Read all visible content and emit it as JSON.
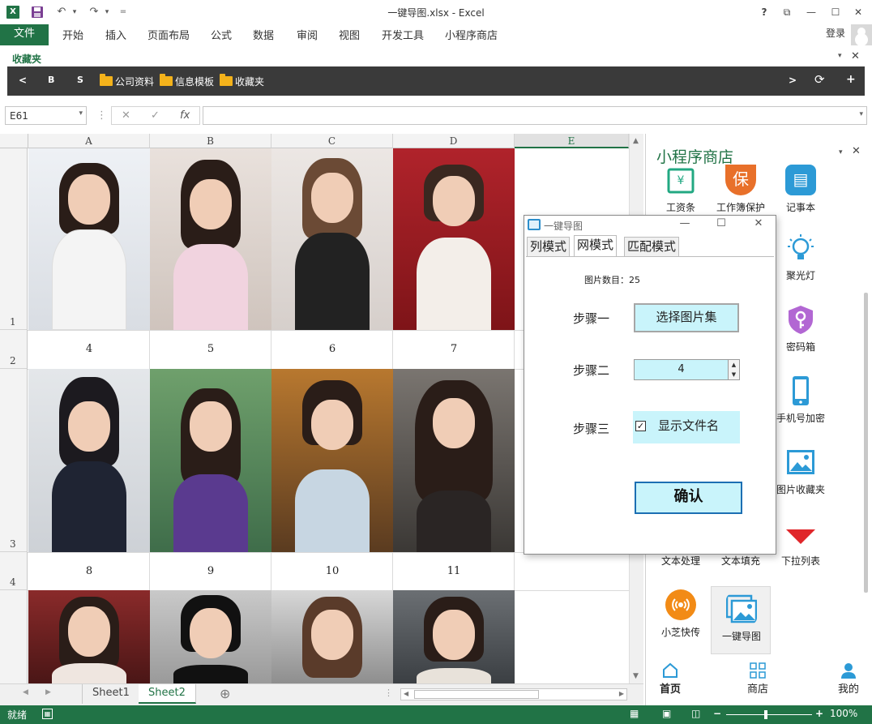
{
  "window": {
    "title": "一键导图.xlsx - Excel",
    "controls": {
      "help": "?",
      "restore_ribbon": "⧉",
      "minimize": "—",
      "maximize": "☐",
      "close": "✕"
    },
    "login": "登录"
  },
  "quick_access": {
    "app_icon": "X",
    "save_icon": "save-icon",
    "undo_icon": "undo-icon",
    "redo_icon": "redo-icon",
    "customize": "="
  },
  "ribbon": {
    "file": "文件",
    "tabs": [
      "开始",
      "插入",
      "页面布局",
      "公式",
      "数据",
      "审阅",
      "视图",
      "开发工具",
      "小程序商店"
    ]
  },
  "favorites": {
    "title": "收藏夹",
    "back": "<",
    "buttons": [
      "B",
      "S"
    ],
    "folders": [
      "公司资料",
      "信息模板",
      "收藏夹"
    ],
    "next": ">",
    "refresh": "⟳",
    "add": "+"
  },
  "formula_bar": {
    "name_box": "E61",
    "dropdown": "▾",
    "dots": "⋮",
    "cancel": "✕",
    "enter": "✓",
    "fx": "fx",
    "value": ""
  },
  "grid": {
    "columns": [
      "A",
      "B",
      "C",
      "D",
      "E"
    ],
    "selected_column": "E",
    "rows": [
      "1",
      "2",
      "3",
      "4"
    ],
    "number_labels": [
      [
        "4",
        "5",
        "6",
        "7"
      ],
      [
        "8",
        "9",
        "10",
        "11"
      ]
    ]
  },
  "sheets": {
    "tabs": [
      "Sheet1",
      "Sheet2"
    ],
    "active": "Sheet2",
    "add": "⊕"
  },
  "status_bar": {
    "ready": "就绪",
    "zoom": "100%",
    "zoom_minus": "−",
    "zoom_plus": "+"
  },
  "side_pane": {
    "title": "小程序商店",
    "items": [
      {
        "label": "工资条",
        "icon": "payroll-icon",
        "color": "#22a882"
      },
      {
        "label": "工作簿保护",
        "icon": "protect-icon",
        "color": "#e8702a"
      },
      {
        "label": "记事本",
        "icon": "notepad-icon",
        "color": "#2c9ad6"
      },
      {
        "label": "聚光灯",
        "icon": "spotlight-icon",
        "color": "#2c9ad6"
      },
      {
        "label": "密码箱",
        "icon": "key-icon",
        "color": "#b267d3"
      },
      {
        "label": "手机号加密",
        "icon": "phone-icon",
        "color": "#2c9ad6"
      },
      {
        "label": "图片收藏夹",
        "icon": "image-icon",
        "color": "#2c9ad6"
      },
      {
        "label": "文本处理",
        "icon": "text-process-icon",
        "color": "#2c9ad6"
      },
      {
        "label": "文本填充",
        "icon": "text-fill-icon",
        "color": "#2c9ad6"
      },
      {
        "label": "下拉列表",
        "icon": "dropdown-icon",
        "color": "#e0262a"
      },
      {
        "label": "小芝快传",
        "icon": "transfer-icon",
        "color": "#f28b16"
      },
      {
        "label": "一键导图",
        "icon": "image-import-icon",
        "color": "#2c9ad6"
      }
    ],
    "nav": [
      {
        "label": "首页",
        "icon": "home-icon"
      },
      {
        "label": "商店",
        "icon": "store-icon"
      },
      {
        "label": "我的",
        "icon": "user-icon"
      }
    ]
  },
  "dialog": {
    "title": "一键导图",
    "tabs": [
      "列模式",
      "网模式",
      "匹配模式"
    ],
    "active_tab": "网模式",
    "image_count_label": "图片数目：25",
    "step1_label": "步骤一",
    "step1_button": "选择图片集",
    "step2_label": "步骤二",
    "step2_value": "4",
    "step3_label": "步骤三",
    "step3_checkbox": "显示文件名",
    "step3_checked": true,
    "ok_button": "确认"
  },
  "colors": {
    "excel_green": "#217346",
    "dialog_cyan": "#c9f4fb",
    "favorites_bar": "#3a3a3a"
  }
}
